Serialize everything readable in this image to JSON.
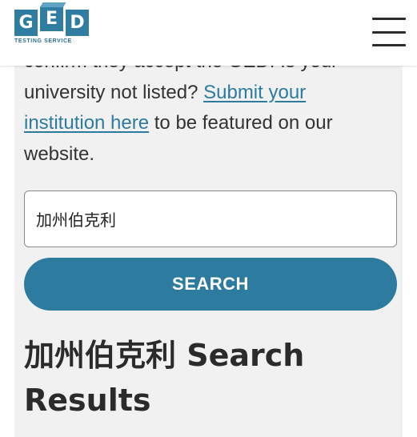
{
  "header": {
    "logo": {
      "letters": [
        "G",
        "E",
        "D"
      ],
      "subtitle": "TESTING SERVICE"
    },
    "menu_icon": "hamburger-menu-icon"
  },
  "main": {
    "paragraph": {
      "partial_top_line": "confirm they accept the GED. Is your",
      "text_before_link": "university not listed? ",
      "link_text": "Submit your institution here",
      "text_after_link": " to be featured on our website."
    },
    "search": {
      "value": "加州伯克利",
      "placeholder": "",
      "button_label": "SEARCH"
    },
    "results_heading": "加州伯克利 Search Results"
  },
  "colors": {
    "brand_blue": "#2e7ba0",
    "content_background": "#f1f1f1",
    "text": "#333333"
  }
}
